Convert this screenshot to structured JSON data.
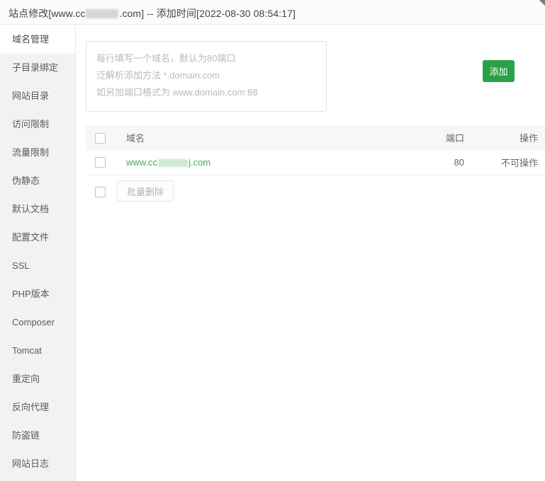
{
  "titlebar": {
    "prefix": "站点修改[www.cc",
    "suffix": ".com] -- 添加时间[2022-08-30 08:54:17]",
    "redacted": true
  },
  "sidebar": {
    "items": [
      {
        "label": "域名管理",
        "active": true
      },
      {
        "label": "子目录绑定",
        "active": false
      },
      {
        "label": "网站目录",
        "active": false
      },
      {
        "label": "访问限制",
        "active": false
      },
      {
        "label": "流量限制",
        "active": false
      },
      {
        "label": "伪静态",
        "active": false
      },
      {
        "label": "默认文档",
        "active": false
      },
      {
        "label": "配置文件",
        "active": false
      },
      {
        "label": "SSL",
        "active": false
      },
      {
        "label": "PHP版本",
        "active": false
      },
      {
        "label": "Composer",
        "active": false
      },
      {
        "label": "Tomcat",
        "active": false
      },
      {
        "label": "重定向",
        "active": false
      },
      {
        "label": "反向代理",
        "active": false
      },
      {
        "label": "防盗链",
        "active": false
      },
      {
        "label": "网站日志",
        "active": false
      }
    ]
  },
  "main": {
    "domain_input": {
      "value": "",
      "placeholder": "每行填写一个域名，默认为80端口\n泛解析添加方法 *.domain.com\n如另加端口格式为 www.domain.com:88"
    },
    "add_button_label": "添加",
    "table": {
      "headers": {
        "domain": "域名",
        "port": "端口",
        "operation": "操作"
      },
      "rows": [
        {
          "domain_prefix": "www.cc",
          "domain_suffix": "j.com",
          "domain_redacted": true,
          "port": "80",
          "operation": "不可操作",
          "checked": false
        }
      ]
    },
    "batch": {
      "select_all_checked": false,
      "delete_label": "批量删除"
    }
  },
  "colors": {
    "accent_green": "#2aa146",
    "link_green": "#3bad5b",
    "sidebar_bg": "#f1f2f3",
    "header_bg": "#fbfbfb",
    "table_header_bg": "#f7f7f7",
    "disabled_text": "#b5b5b5"
  }
}
